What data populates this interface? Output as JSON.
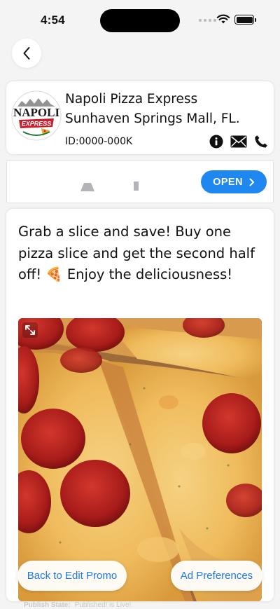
{
  "status_bar": {
    "time": "4:54"
  },
  "business": {
    "name": "Napoli Pizza Express",
    "location": "Sunhaven Springs Mall, FL.",
    "id": "ID:0000-000K",
    "logo_text_top": "NAPOLI",
    "logo_text_bottom": "EXPRESS"
  },
  "ad_banner": {
    "open_label": "OPEN"
  },
  "promo": {
    "text": "Grab a slice and save! Buy one pizza slice and get the second half off! 🍕 Enjoy the deliciousness!"
  },
  "buttons": {
    "back_to_edit": "Back to Edit Promo",
    "ad_preferences": "Ad Preferences"
  },
  "publish": {
    "label": "Publish State:",
    "value": "Published! is Live!"
  },
  "colors": {
    "accent": "#1e88f0",
    "link": "#1e7ae0",
    "logo_red": "#c8202f",
    "logo_green": "#1f7a3a"
  }
}
